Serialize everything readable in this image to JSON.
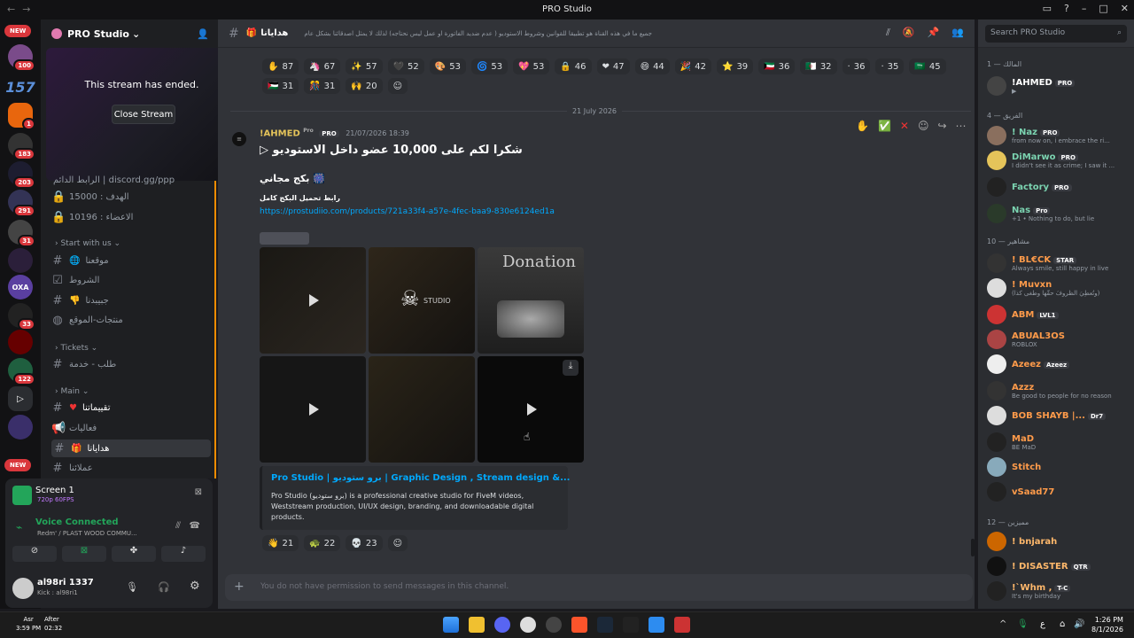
{
  "window": {
    "title": "PRO Studio"
  },
  "server": {
    "name": "PRO Studio",
    "badges": [
      "100",
      "1",
      "183",
      "203",
      "291",
      "31",
      "33",
      "122"
    ],
    "new_label": "NEW"
  },
  "stream_panel": {
    "message": "This stream has ended.",
    "close_label": "Close Stream"
  },
  "channels": {
    "invite": "الرابط الدائم | discord.gg/ppp",
    "goal": "الهدف : 15000",
    "members_count": "الاعضاء : 10196",
    "cat_start": "Start with us",
    "start_items": [
      "موقعنا",
      "الشروط",
      "جبيبدنا",
      "منتجات-الموقع"
    ],
    "cat_tickets": "Tickets",
    "tickets_items": [
      "طلب - خدمة"
    ],
    "cat_main": "Main",
    "main_items": [
      "تقييماتنا",
      "فعاليات",
      "هدايانا",
      "عملائنا"
    ]
  },
  "voice": {
    "screen": "Screen 1",
    "quality": "720p 60FPS",
    "status": "Voice Connected",
    "channel": "Redm' / PLAST WOOD COMMU...",
    "user": "al98ri 1337",
    "user_sub": "Kick : al98ri1"
  },
  "topbar": {
    "channel": "هدايانا",
    "topic": "جميع ما في هذه القناة هو تطبيقا للقوانين وشروط الاستوديو ( عدم ضديد الفاتورة او عمل ليس نحتاجه) لذلك لا يمثل اصدقائنا بشكل عام"
  },
  "reactions_top": [
    [
      "87",
      "✋"
    ],
    [
      "67",
      "🦄"
    ],
    [
      "57",
      "✨"
    ],
    [
      "52",
      "🖤"
    ],
    [
      "53",
      "🎨"
    ],
    [
      "53",
      "🌀"
    ],
    [
      "53",
      "💖"
    ],
    [
      "46",
      "🔒"
    ],
    [
      "47",
      "❤"
    ],
    [
      "44",
      "😄"
    ],
    [
      "42",
      "🎉"
    ],
    [
      "39",
      "⭐"
    ],
    [
      "36",
      "🇰🇼"
    ],
    [
      "32",
      "🇩🇿"
    ],
    [
      "36",
      "·"
    ],
    [
      "35",
      "·"
    ],
    [
      "45",
      "🇸🇦"
    ],
    [
      "31",
      "🇵🇸"
    ],
    [
      "31",
      "🎊"
    ],
    [
      "20",
      "🙌"
    ]
  ],
  "date_divider": "21 July 2026",
  "message": {
    "author": "!AHMED",
    "pro": "Pro",
    "badge": "PRO",
    "timestamp": "21/07/2026 18:39",
    "headline": "شكرا لكم على 10,000 عضو داخل الاستوديو",
    "subline": "بكج مجاني",
    "link_label": "رابط تحميل البكج كامل",
    "link": "https://prostudiio.com/products/721a33f4-a57e-4fec-baa9-830e6124ed1a",
    "embed_title": "Pro Studio | برو ستوديو | Graphic Design , Stream design &...",
    "embed_desc": "Pro Studio (برو ستوديو) is a professional creative studio for FiveM videos, Weststream production, UI/UX design, branding, and downloadable digital products.",
    "reactions": [
      [
        "21",
        "👋"
      ],
      [
        "22",
        "🐢"
      ],
      [
        "23",
        "💀"
      ]
    ],
    "thumb_text_1": "Donation",
    "thumb_text_2": "STUDIO"
  },
  "compose": {
    "placeholder": "You do not have permission to send messages in this channel."
  },
  "search": {
    "placeholder": "Search PRO Studio"
  },
  "members": {
    "cats": [
      "المالك — 1",
      "الفريق — 4",
      "مشاهير — 10",
      "مميزين — 12"
    ],
    "list": [
      {
        "name": "!AHMED",
        "tag": "PRO",
        "sub": "▶",
        "color": "#ffffff",
        "av": "#444"
      },
      {
        "name": "! Naz",
        "tag": "PRO",
        "sub": "from now on, i embrace the ri...",
        "color": "#7bd3b0",
        "av": "#8a6f5e"
      },
      {
        "name": "DiMarwo",
        "tag": "PRO",
        "sub": "I didn't see it as crime; I saw it ...",
        "color": "#7bd3b0",
        "av": "#e5c45a"
      },
      {
        "name": "Factory",
        "tag": "PRO",
        "sub": "",
        "color": "#7bd3b0",
        "av": "#222"
      },
      {
        "name": "Nas",
        "tag": "Pro",
        "sub": "+1 • Nothing to do, but lie",
        "color": "#7bd3b0",
        "av": "#2a3a2a"
      },
      {
        "name": "! BL€CK",
        "tag": "STAR",
        "sub": "Always smile, still happy in live",
        "color": "#ff9b4a",
        "av": "#333"
      },
      {
        "name": "! Muvxn",
        "tag": "",
        "sub": "(وتُعطِيَ الظروفَ حقّها وطغى كذا)",
        "color": "#ff9b4a",
        "av": "#ddd"
      },
      {
        "name": "ABM",
        "tag": "LVL1",
        "sub": "",
        "color": "#ff9b4a",
        "av": "#c33"
      },
      {
        "name": "ABUAL3OS",
        "tag": "",
        "sub": "ROBLOX",
        "color": "#ff9b4a",
        "av": "#a44"
      },
      {
        "name": "Azeez",
        "tag": "Azeez",
        "sub": "",
        "color": "#ff9b4a",
        "av": "#eee"
      },
      {
        "name": "Azzz",
        "tag": "",
        "sub": "Be good to people for no reason",
        "color": "#ff9b4a",
        "av": "#333"
      },
      {
        "name": "BOB SHAYB |...",
        "tag": "Dr7",
        "sub": "",
        "color": "#ff9b4a",
        "av": "#ddd"
      },
      {
        "name": "MaD",
        "tag": "",
        "sub": "BE MaD",
        "color": "#ff9b4a",
        "av": "#222"
      },
      {
        "name": "Stitch",
        "tag": "",
        "sub": "",
        "color": "#ff9b4a",
        "av": "#8ab"
      },
      {
        "name": "vSaad77",
        "tag": "",
        "sub": "",
        "color": "#ff9b4a",
        "av": "#222"
      },
      {
        "name": "! bnjarah",
        "tag": "",
        "sub": "",
        "color": "#ffb86b",
        "av": "#c60"
      },
      {
        "name": "! DISASTER",
        "tag": "QTR",
        "sub": "",
        "color": "#ffb86b",
        "av": "#111"
      },
      {
        "name": "!`Whm ,",
        "tag": "T-C",
        "sub": "It's my birthday",
        "color": "#ffb86b",
        "av": "#222"
      }
    ]
  },
  "taskbar": {
    "prayer": "Asr",
    "prayer_time": "3:59 PM",
    "after": "After",
    "countdown": "02:32",
    "time": "1:26 PM",
    "date": "8/1/2026",
    "lang": "ع"
  },
  "colors": {
    "accent": "#5865f2",
    "link": "#00a8fc",
    "orange_border": "#f08c00",
    "bg": "#313338"
  }
}
